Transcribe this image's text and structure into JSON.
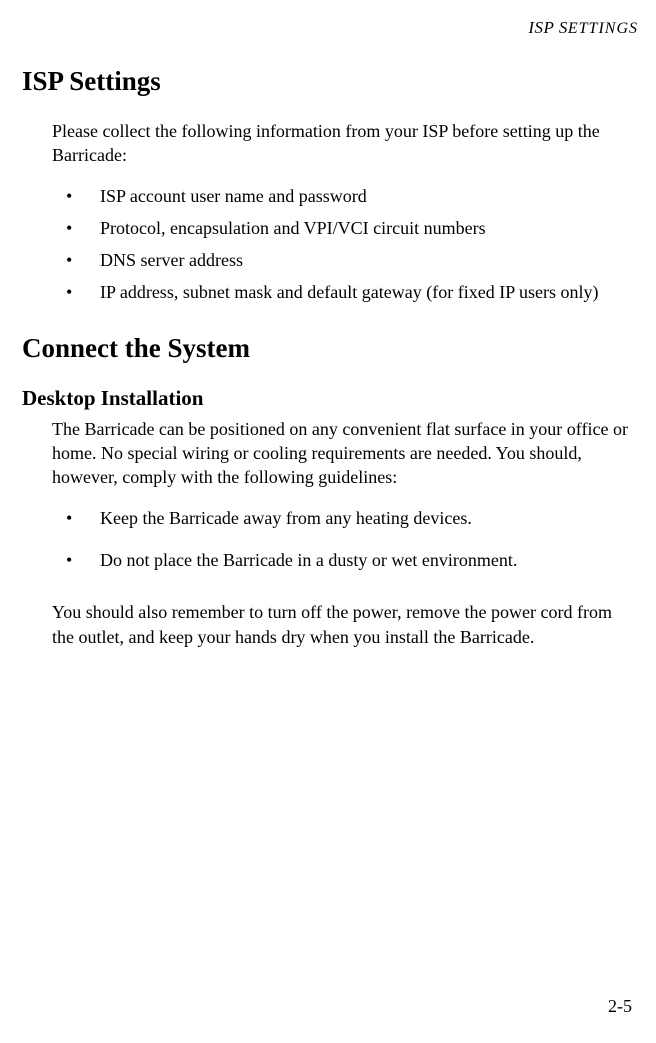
{
  "running_head": {
    "prefix": "ISP S",
    "small_caps_tail": "ETTINGS"
  },
  "section1": {
    "title": "ISP Settings",
    "intro": "Please collect the following information from your ISP before setting up the Barricade:",
    "bullets": [
      "ISP account user name and password",
      "Protocol, encapsulation and VPI/VCI circuit numbers",
      "DNS server address",
      "IP address, subnet mask and default gateway (for fixed IP users only)"
    ]
  },
  "section2": {
    "title": "Connect the System",
    "subsection_title": "Desktop Installation",
    "intro": "The Barricade can be positioned on any convenient flat surface in your office or home. No special wiring or cooling requirements are needed. You should, however, comply with the following guidelines:",
    "bullets": [
      "Keep the Barricade away from any heating devices.",
      "Do not place the Barricade in a dusty or wet environment."
    ],
    "outro": "You should also remember to turn off the power, remove the power cord from the outlet, and keep your hands dry when you install the Barricade."
  },
  "page_number": "2-5"
}
